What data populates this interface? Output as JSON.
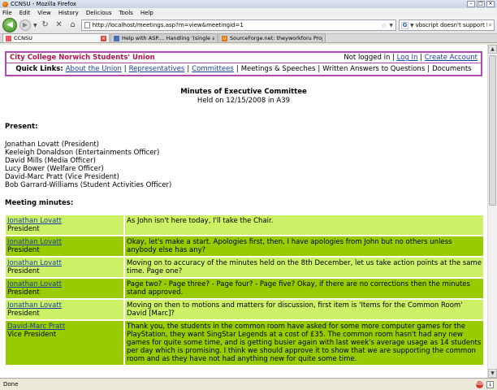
{
  "window": {
    "title": "CCNSU - Mozilla Firefox"
  },
  "menu": [
    "File",
    "Edit",
    "View",
    "History",
    "Delicious",
    "Tools",
    "Help"
  ],
  "nav": {
    "url": "http://localhost/meetings.asp?m=view&meetingid=1",
    "search_value": "vbscript doesn't support time"
  },
  "tabs": [
    {
      "label": "CCNSU",
      "active": true
    },
    {
      "label": "Help with ASP.... Handling '(single apos)...",
      "active": false
    },
    {
      "label": "SourceForge.net: theyworkforu Proje...",
      "active": false
    }
  ],
  "site": {
    "brand": "City College Norwich Students' Union",
    "not_logged_in": "Not logged in",
    "login": "Log In",
    "create_account": "Create Account",
    "quick_links_label": "Quick Links:",
    "links": {
      "about": "About the Union",
      "reps": "Representatives",
      "committees": "Committees",
      "meetings": "Meetings & Speeches",
      "answers": "Written Answers to Questions",
      "documents": "Documents"
    }
  },
  "minutes": {
    "title": "Minutes of Executive Committee",
    "held": "Held on 12/15/2008 in A39",
    "present_heading": "Present:",
    "present": [
      "Jonathan Lovatt (President)",
      "Keeleigh Donaldson (Entertainments Officer)",
      "David Mills (Media Officer)",
      "Lucy Bower (Welfare Officer)",
      "David-Marc Pratt (Vice President)",
      "Bob Garrard-Williams (Student Activities Officer)"
    ],
    "meeting_heading": "Meeting minutes:",
    "entries": [
      {
        "name": "Jonathan Lovatt",
        "role": "President",
        "text": "As John isn't here today, I'll take the Chair."
      },
      {
        "name": "Jonathan Lovatt",
        "role": "President",
        "text": "Okay, let's make a start. Apologies first, then, I have apologies from John but no others unless anybody else has any?"
      },
      {
        "name": "Jonathan Lovatt",
        "role": "President",
        "text": "Moving on to accuracy of the minutes held on the 8th December, let us take action points at the same time. Page one?"
      },
      {
        "name": "Jonathan Lovatt",
        "role": "President",
        "text": "Page two? - Page three? - Page four? - Page five? Okay, if there are no corrections then the minutes stand approved."
      },
      {
        "name": "Jonathan Lovatt",
        "role": "President",
        "text": "Moving on then to motions and matters for discussion, first item is 'Items for the Common Room' David [Marc]?"
      },
      {
        "name": "David-Marc Pratt",
        "role": "Vice President",
        "text": "Thank you, the students in the common room have asked for some more computer games for the PlayStation, they want SingStar Legends at a cost of £35. The common room hasn't had any new games for quite some time, and is getting busier again with last week's average usage as 14 students per day which is promising. I think we should approve it to show that we are supporting the common room and as they have not had anything new for quite some time."
      }
    ]
  },
  "status": {
    "text": "Done"
  }
}
